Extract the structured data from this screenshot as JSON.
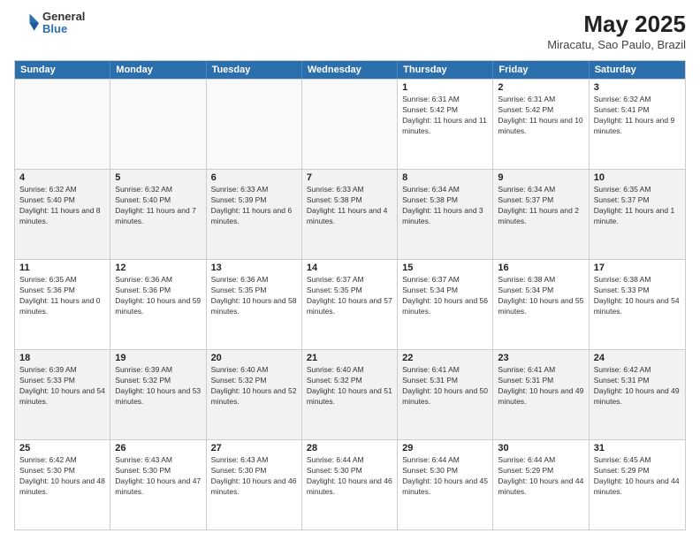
{
  "header": {
    "logo": {
      "general": "General",
      "blue": "Blue"
    },
    "title": "May 2025",
    "location": "Miracatu, Sao Paulo, Brazil"
  },
  "days_of_week": [
    "Sunday",
    "Monday",
    "Tuesday",
    "Wednesday",
    "Thursday",
    "Friday",
    "Saturday"
  ],
  "rows": [
    [
      {
        "day": "",
        "empty": true
      },
      {
        "day": "",
        "empty": true
      },
      {
        "day": "",
        "empty": true
      },
      {
        "day": "",
        "empty": true
      },
      {
        "day": "1",
        "sunrise": "6:31 AM",
        "sunset": "5:42 PM",
        "daylight": "11 hours and 11 minutes."
      },
      {
        "day": "2",
        "sunrise": "6:31 AM",
        "sunset": "5:42 PM",
        "daylight": "11 hours and 10 minutes."
      },
      {
        "day": "3",
        "sunrise": "6:32 AM",
        "sunset": "5:41 PM",
        "daylight": "11 hours and 9 minutes."
      }
    ],
    [
      {
        "day": "4",
        "sunrise": "6:32 AM",
        "sunset": "5:40 PM",
        "daylight": "11 hours and 8 minutes."
      },
      {
        "day": "5",
        "sunrise": "6:32 AM",
        "sunset": "5:40 PM",
        "daylight": "11 hours and 7 minutes."
      },
      {
        "day": "6",
        "sunrise": "6:33 AM",
        "sunset": "5:39 PM",
        "daylight": "11 hours and 6 minutes."
      },
      {
        "day": "7",
        "sunrise": "6:33 AM",
        "sunset": "5:38 PM",
        "daylight": "11 hours and 4 minutes."
      },
      {
        "day": "8",
        "sunrise": "6:34 AM",
        "sunset": "5:38 PM",
        "daylight": "11 hours and 3 minutes."
      },
      {
        "day": "9",
        "sunrise": "6:34 AM",
        "sunset": "5:37 PM",
        "daylight": "11 hours and 2 minutes."
      },
      {
        "day": "10",
        "sunrise": "6:35 AM",
        "sunset": "5:37 PM",
        "daylight": "11 hours and 1 minute."
      }
    ],
    [
      {
        "day": "11",
        "sunrise": "6:35 AM",
        "sunset": "5:36 PM",
        "daylight": "11 hours and 0 minutes."
      },
      {
        "day": "12",
        "sunrise": "6:36 AM",
        "sunset": "5:36 PM",
        "daylight": "10 hours and 59 minutes."
      },
      {
        "day": "13",
        "sunrise": "6:36 AM",
        "sunset": "5:35 PM",
        "daylight": "10 hours and 58 minutes."
      },
      {
        "day": "14",
        "sunrise": "6:37 AM",
        "sunset": "5:35 PM",
        "daylight": "10 hours and 57 minutes."
      },
      {
        "day": "15",
        "sunrise": "6:37 AM",
        "sunset": "5:34 PM",
        "daylight": "10 hours and 56 minutes."
      },
      {
        "day": "16",
        "sunrise": "6:38 AM",
        "sunset": "5:34 PM",
        "daylight": "10 hours and 55 minutes."
      },
      {
        "day": "17",
        "sunrise": "6:38 AM",
        "sunset": "5:33 PM",
        "daylight": "10 hours and 54 minutes."
      }
    ],
    [
      {
        "day": "18",
        "sunrise": "6:39 AM",
        "sunset": "5:33 PM",
        "daylight": "10 hours and 54 minutes."
      },
      {
        "day": "19",
        "sunrise": "6:39 AM",
        "sunset": "5:32 PM",
        "daylight": "10 hours and 53 minutes."
      },
      {
        "day": "20",
        "sunrise": "6:40 AM",
        "sunset": "5:32 PM",
        "daylight": "10 hours and 52 minutes."
      },
      {
        "day": "21",
        "sunrise": "6:40 AM",
        "sunset": "5:32 PM",
        "daylight": "10 hours and 51 minutes."
      },
      {
        "day": "22",
        "sunrise": "6:41 AM",
        "sunset": "5:31 PM",
        "daylight": "10 hours and 50 minutes."
      },
      {
        "day": "23",
        "sunrise": "6:41 AM",
        "sunset": "5:31 PM",
        "daylight": "10 hours and 49 minutes."
      },
      {
        "day": "24",
        "sunrise": "6:42 AM",
        "sunset": "5:31 PM",
        "daylight": "10 hours and 49 minutes."
      }
    ],
    [
      {
        "day": "25",
        "sunrise": "6:42 AM",
        "sunset": "5:30 PM",
        "daylight": "10 hours and 48 minutes."
      },
      {
        "day": "26",
        "sunrise": "6:43 AM",
        "sunset": "5:30 PM",
        "daylight": "10 hours and 47 minutes."
      },
      {
        "day": "27",
        "sunrise": "6:43 AM",
        "sunset": "5:30 PM",
        "daylight": "10 hours and 46 minutes."
      },
      {
        "day": "28",
        "sunrise": "6:44 AM",
        "sunset": "5:30 PM",
        "daylight": "10 hours and 46 minutes."
      },
      {
        "day": "29",
        "sunrise": "6:44 AM",
        "sunset": "5:30 PM",
        "daylight": "10 hours and 45 minutes."
      },
      {
        "day": "30",
        "sunrise": "6:44 AM",
        "sunset": "5:29 PM",
        "daylight": "10 hours and 44 minutes."
      },
      {
        "day": "31",
        "sunrise": "6:45 AM",
        "sunset": "5:29 PM",
        "daylight": "10 hours and 44 minutes."
      }
    ]
  ],
  "labels": {
    "sunrise": "Sunrise:",
    "sunset": "Sunset:",
    "daylight": "Daylight hours"
  }
}
